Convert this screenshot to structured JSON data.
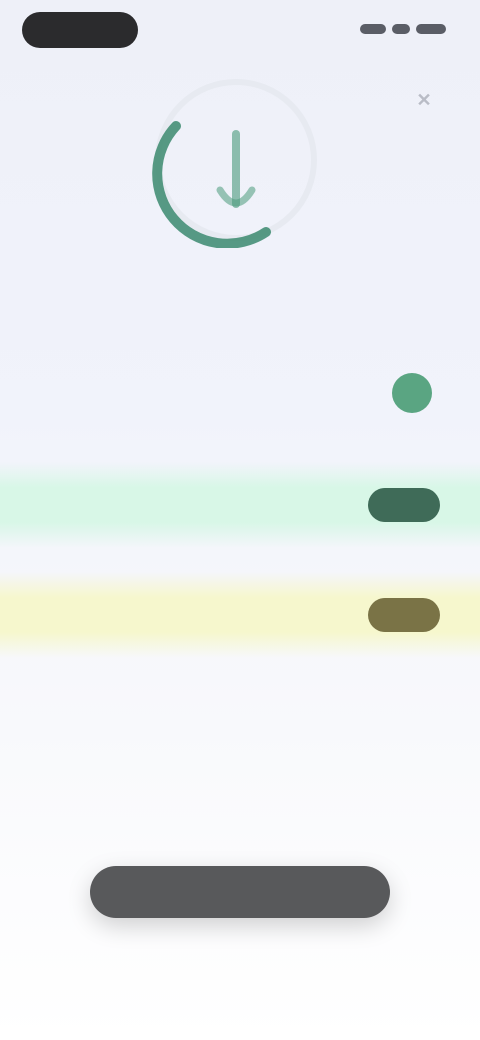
{
  "status_bar": {
    "left_pill": "",
    "right_indicators": ""
  },
  "header": {
    "close_icon": "close-icon",
    "close_glyph": "✕"
  },
  "hero": {
    "icon": "app-ring-icon",
    "accent_color": "#2f7d64",
    "subtitle": ""
  },
  "options": [
    {
      "title": "",
      "subtitle": "",
      "control": "toggle",
      "accent": "#5aa582"
    },
    {
      "title": "",
      "subtitle": "",
      "button_label": "",
      "accent": "#3f6b58",
      "background": "#d8f7e7"
    },
    {
      "title": "",
      "subtitle": "",
      "button_label": "",
      "accent": "#7a7346",
      "background": "#f6f7cd"
    }
  ],
  "footer": {
    "primary_button_label": ""
  }
}
